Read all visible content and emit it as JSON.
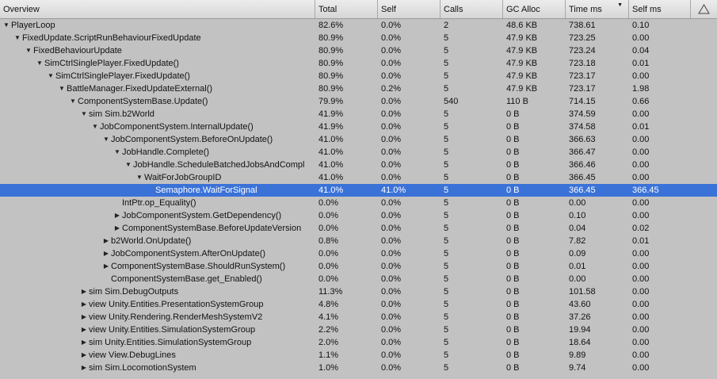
{
  "columns": [
    "Overview",
    "Total",
    "Self",
    "Calls",
    "GC Alloc",
    "Time ms",
    "Self ms"
  ],
  "icons": {
    "sort": "sort-descending-icon",
    "warning": "warning-triangle-icon",
    "expanded": "triangle-down-icon",
    "collapsed": "triangle-right-icon"
  },
  "colors": {
    "background": "#c2c2c2",
    "selected": "#3a72d8"
  },
  "rows": [
    {
      "depth": 0,
      "arrow": "expanded",
      "name": "PlayerLoop",
      "total": "82.6%",
      "self": "0.0%",
      "calls": "2",
      "gc": "48.6 KB",
      "time": "738.61",
      "selfms": "0.10"
    },
    {
      "depth": 1,
      "arrow": "expanded",
      "name": "FixedUpdate.ScriptRunBehaviourFixedUpdate",
      "total": "80.9%",
      "self": "0.0%",
      "calls": "5",
      "gc": "47.9 KB",
      "time": "723.25",
      "selfms": "0.00"
    },
    {
      "depth": 2,
      "arrow": "expanded",
      "name": "FixedBehaviourUpdate",
      "total": "80.9%",
      "self": "0.0%",
      "calls": "5",
      "gc": "47.9 KB",
      "time": "723.24",
      "selfms": "0.04"
    },
    {
      "depth": 3,
      "arrow": "expanded",
      "name": "SimCtrlSinglePlayer.FixedUpdate()",
      "total": "80.9%",
      "self": "0.0%",
      "calls": "5",
      "gc": "47.9 KB",
      "time": "723.18",
      "selfms": "0.01"
    },
    {
      "depth": 4,
      "arrow": "expanded",
      "name": "SimCtrlSinglePlayer.FixedUpdate()",
      "total": "80.9%",
      "self": "0.0%",
      "calls": "5",
      "gc": "47.9 KB",
      "time": "723.17",
      "selfms": "0.00"
    },
    {
      "depth": 5,
      "arrow": "expanded",
      "name": "BattleManager.FixedUpdateExternal()",
      "total": "80.9%",
      "self": "0.2%",
      "calls": "5",
      "gc": "47.9 KB",
      "time": "723.17",
      "selfms": "1.98"
    },
    {
      "depth": 6,
      "arrow": "expanded",
      "name": "ComponentSystemBase.Update()",
      "total": "79.9%",
      "self": "0.0%",
      "calls": "540",
      "gc": "110 B",
      "time": "714.15",
      "selfms": "0.66"
    },
    {
      "depth": 7,
      "arrow": "expanded",
      "name": "sim Sim.b2World",
      "total": "41.9%",
      "self": "0.0%",
      "calls": "5",
      "gc": "0 B",
      "time": "374.59",
      "selfms": "0.00"
    },
    {
      "depth": 8,
      "arrow": "expanded",
      "name": "JobComponentSystem.InternalUpdate()",
      "total": "41.9%",
      "self": "0.0%",
      "calls": "5",
      "gc": "0 B",
      "time": "374.58",
      "selfms": "0.01"
    },
    {
      "depth": 9,
      "arrow": "expanded",
      "name": "JobComponentSystem.BeforeOnUpdate()",
      "total": "41.0%",
      "self": "0.0%",
      "calls": "5",
      "gc": "0 B",
      "time": "366.63",
      "selfms": "0.00"
    },
    {
      "depth": 10,
      "arrow": "expanded",
      "name": "JobHandle.Complete()",
      "total": "41.0%",
      "self": "0.0%",
      "calls": "5",
      "gc": "0 B",
      "time": "366.47",
      "selfms": "0.00"
    },
    {
      "depth": 11,
      "arrow": "expanded",
      "name": "JobHandle.ScheduleBatchedJobsAndCompl",
      "total": "41.0%",
      "self": "0.0%",
      "calls": "5",
      "gc": "0 B",
      "time": "366.46",
      "selfms": "0.00"
    },
    {
      "depth": 12,
      "arrow": "expanded",
      "name": "WaitForJobGroupID",
      "total": "41.0%",
      "self": "0.0%",
      "calls": "5",
      "gc": "0 B",
      "time": "366.45",
      "selfms": "0.00"
    },
    {
      "depth": 13,
      "arrow": "none",
      "name": "Semaphore.WaitForSignal",
      "total": "41.0%",
      "self": "41.0%",
      "calls": "5",
      "gc": "0 B",
      "time": "366.45",
      "selfms": "366.45",
      "selected": true
    },
    {
      "depth": 10,
      "arrow": "none",
      "name": "IntPtr.op_Equality()",
      "total": "0.0%",
      "self": "0.0%",
      "calls": "5",
      "gc": "0 B",
      "time": "0.00",
      "selfms": "0.00"
    },
    {
      "depth": 10,
      "arrow": "collapsed",
      "name": "JobComponentSystem.GetDependency()",
      "total": "0.0%",
      "self": "0.0%",
      "calls": "5",
      "gc": "0 B",
      "time": "0.10",
      "selfms": "0.00"
    },
    {
      "depth": 10,
      "arrow": "collapsed",
      "name": "ComponentSystemBase.BeforeUpdateVersion",
      "total": "0.0%",
      "self": "0.0%",
      "calls": "5",
      "gc": "0 B",
      "time": "0.04",
      "selfms": "0.02"
    },
    {
      "depth": 9,
      "arrow": "collapsed",
      "name": "b2World.OnUpdate()",
      "total": "0.8%",
      "self": "0.0%",
      "calls": "5",
      "gc": "0 B",
      "time": "7.82",
      "selfms": "0.01"
    },
    {
      "depth": 9,
      "arrow": "collapsed",
      "name": "JobComponentSystem.AfterOnUpdate()",
      "total": "0.0%",
      "self": "0.0%",
      "calls": "5",
      "gc": "0 B",
      "time": "0.09",
      "selfms": "0.00"
    },
    {
      "depth": 9,
      "arrow": "collapsed",
      "name": "ComponentSystemBase.ShouldRunSystem()",
      "total": "0.0%",
      "self": "0.0%",
      "calls": "5",
      "gc": "0 B",
      "time": "0.01",
      "selfms": "0.00"
    },
    {
      "depth": 9,
      "arrow": "none",
      "name": "ComponentSystemBase.get_Enabled()",
      "total": "0.0%",
      "self": "0.0%",
      "calls": "5",
      "gc": "0 B",
      "time": "0.00",
      "selfms": "0.00"
    },
    {
      "depth": 7,
      "arrow": "collapsed",
      "name": "sim Sim.DebugOutputs",
      "total": "11.3%",
      "self": "0.0%",
      "calls": "5",
      "gc": "0 B",
      "time": "101.58",
      "selfms": "0.00"
    },
    {
      "depth": 7,
      "arrow": "collapsed",
      "name": "view Unity.Entities.PresentationSystemGroup",
      "total": "4.8%",
      "self": "0.0%",
      "calls": "5",
      "gc": "0 B",
      "time": "43.60",
      "selfms": "0.00"
    },
    {
      "depth": 7,
      "arrow": "collapsed",
      "name": "view Unity.Rendering.RenderMeshSystemV2",
      "total": "4.1%",
      "self": "0.0%",
      "calls": "5",
      "gc": "0 B",
      "time": "37.26",
      "selfms": "0.00"
    },
    {
      "depth": 7,
      "arrow": "collapsed",
      "name": "view Unity.Entities.SimulationSystemGroup",
      "total": "2.2%",
      "self": "0.0%",
      "calls": "5",
      "gc": "0 B",
      "time": "19.94",
      "selfms": "0.00"
    },
    {
      "depth": 7,
      "arrow": "collapsed",
      "name": "sim Unity.Entities.SimulationSystemGroup",
      "total": "2.0%",
      "self": "0.0%",
      "calls": "5",
      "gc": "0 B",
      "time": "18.64",
      "selfms": "0.00"
    },
    {
      "depth": 7,
      "arrow": "collapsed",
      "name": "view View.DebugLines",
      "total": "1.1%",
      "self": "0.0%",
      "calls": "5",
      "gc": "0 B",
      "time": "9.89",
      "selfms": "0.00"
    },
    {
      "depth": 7,
      "arrow": "collapsed",
      "name": "sim Sim.LocomotionSystem",
      "total": "1.0%",
      "self": "0.0%",
      "calls": "5",
      "gc": "0 B",
      "time": "9.74",
      "selfms": "0.00"
    }
  ]
}
